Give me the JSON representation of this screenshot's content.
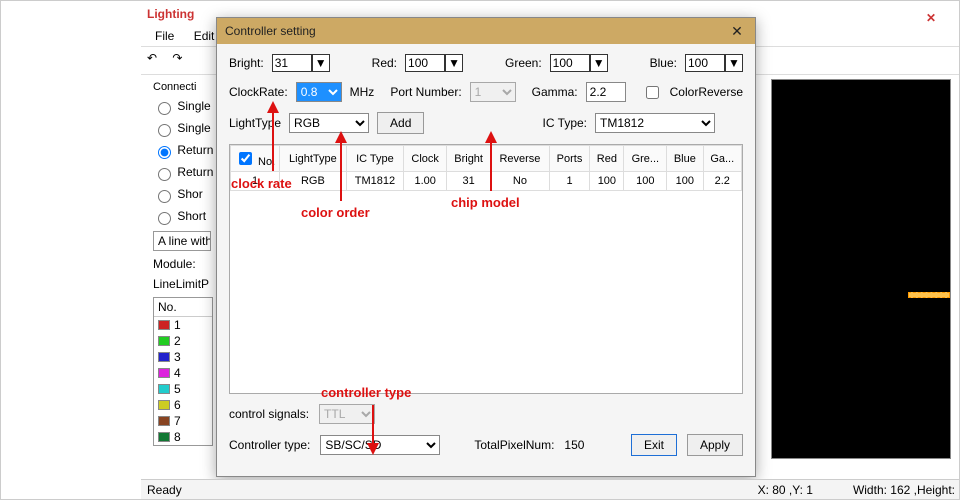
{
  "main_window": {
    "title": "Lighting",
    "menubar": [
      "File",
      "Edit"
    ],
    "close_glyph": "✕",
    "toolbar": {
      "undo": "↶",
      "redo": "↷"
    }
  },
  "side_panel": {
    "conn_label": "Connecti",
    "radios": [
      "Single",
      "Single",
      "Return",
      "Return",
      "Shor",
      "Short"
    ],
    "selected_radio_idx": 2,
    "line_option": "A line with",
    "module_label": "Module:",
    "line_limit_label": "LineLimitP",
    "color_header": "No.",
    "colors": [
      {
        "n": "1",
        "c": "#cc2222"
      },
      {
        "n": "2",
        "c": "#22cc22"
      },
      {
        "n": "3",
        "c": "#2222cc"
      },
      {
        "n": "4",
        "c": "#dd22dd"
      },
      {
        "n": "5",
        "c": "#22cccc"
      },
      {
        "n": "6",
        "c": "#cccc22"
      },
      {
        "n": "7",
        "c": "#884422"
      },
      {
        "n": "8",
        "c": "#117733"
      }
    ]
  },
  "modal": {
    "title": "Controller setting",
    "close_glyph": "✕",
    "bright_label": "Bright:",
    "bright_value": "31",
    "red_label": "Red:",
    "red_value": "100",
    "green_label": "Green:",
    "green_value": "100",
    "blue_label": "Blue:",
    "blue_value": "100",
    "clockrate_label": "ClockRate:",
    "clockrate_value": "0.8",
    "clockrate_unit": "MHz",
    "portnum_label": "Port Number:",
    "portnum_value": "1",
    "gamma_label": "Gamma:",
    "gamma_value": "2.2",
    "colorrev_label": "ColorReverse",
    "lighttype_label": "LightType",
    "lighttype_value": "RGB",
    "add_btn": "Add",
    "ictype_label": "IC Type:",
    "ictype_value": "TM1812",
    "grid_headers": [
      "No.",
      "LightType",
      "IC Type",
      "Clock",
      "Bright",
      "Reverse",
      "Ports",
      "Red",
      "Gre...",
      "Blue",
      "Ga..."
    ],
    "grid_row": [
      "1",
      "RGB",
      "TM1812",
      "1.00",
      "31",
      "No",
      "1",
      "100",
      "100",
      "100",
      "2.2"
    ],
    "ctrlsig_label": "control signals:",
    "ctrlsig_value": "TTL",
    "ctrltype_label": "Controller type:",
    "ctrltype_value": "SB/SC/SD",
    "totalpixel_label": "TotalPixelNum:",
    "totalpixel_value": "150",
    "exit_btn": "Exit",
    "apply_btn": "Apply"
  },
  "annotations": {
    "clock_rate": "clock rate",
    "color_order": "color order",
    "chip_model": "chip model",
    "controller_type": "controller type"
  },
  "statusbar": {
    "ready": "Ready",
    "xy": "X: 80 ,Y: 1",
    "wh": "Width: 162 ,Height:"
  }
}
